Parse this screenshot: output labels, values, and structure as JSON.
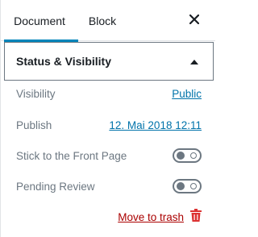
{
  "tabs": [
    {
      "label": "Document",
      "active": true
    },
    {
      "label": "Block",
      "active": false
    }
  ],
  "panel": {
    "title": "Status & Visibility",
    "expanded": true,
    "visibility_label": "Visibility",
    "visibility_value": "Public",
    "publish_label": "Publish",
    "publish_value": "12. Mai 2018 12:11",
    "sticky_label": "Stick to the Front Page",
    "sticky_on": false,
    "pending_label": "Pending Review",
    "pending_on": false,
    "trash_label": "Move to trash"
  },
  "colors": {
    "accent": "#0085ba",
    "link": "#0073aa",
    "danger": "#dc3232"
  },
  "icons": {
    "close": "close-icon",
    "collapse": "caret-up-icon",
    "trash": "trash-icon"
  }
}
